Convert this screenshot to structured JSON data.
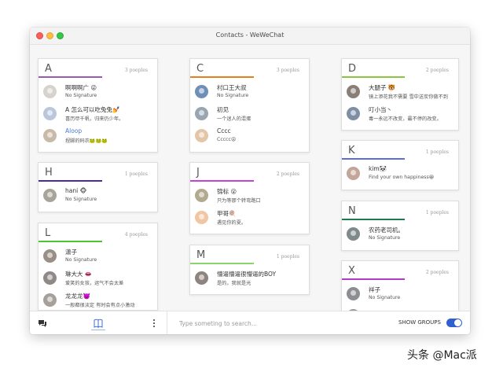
{
  "window": {
    "title": "Contacts - WeWeChat"
  },
  "groups": [
    {
      "letter": "A",
      "count": "3 poeples",
      "accent": "#9b59b6",
      "contacts": [
        {
          "name": "啊啊啊广 😜",
          "signature": "No Signature",
          "avatar_color": "#d7d2cc"
        },
        {
          "name": "A 怎么可以吃兔兔💅",
          "signature": "喜历尽千帆，归来仍少年。",
          "avatar_color": "#b9c6db"
        },
        {
          "name": "Aloop",
          "signature": "捏脚的码农🐸🐸🐸",
          "avatar_color": "#c9b9a9",
          "link": true
        }
      ]
    },
    {
      "letter": "H",
      "count": "1 poeples",
      "accent": "#4a2aa0",
      "contacts": [
        {
          "name": "hani 🐵",
          "signature": "No Signature",
          "avatar_color": "#a9a49a"
        }
      ]
    },
    {
      "letter": "L",
      "count": "4 poeples",
      "accent": "#4cc531",
      "contacts": [
        {
          "name": "潇子",
          "signature": "No Signature",
          "avatar_color": "#9a8f86"
        },
        {
          "name": "琳大大 👄",
          "signature": "爱笑的女孩，运气不会太差",
          "avatar_color": "#8f8a87"
        },
        {
          "name": "龙龙龙👿",
          "signature": "一般都很淡定 有时会有点小激动",
          "avatar_color": "#a5a09a"
        }
      ]
    },
    {
      "letter": "C",
      "count": "3 poeples",
      "accent": "#e67e22",
      "contacts": [
        {
          "name": "村口王大叔",
          "signature": "No Signature",
          "avatar_color": "#6f8fb8"
        },
        {
          "name": "初见",
          "signature": "一个迷人的混蛋",
          "avatar_color": "#98a6b4"
        },
        {
          "name": "Cccc",
          "signature": "Ccccc😡",
          "avatar_color": "#e3c6a8"
        }
      ]
    },
    {
      "letter": "J",
      "count": "2 poeples",
      "accent": "#c243d6",
      "contacts": [
        {
          "name": "锦标 😮",
          "signature": "只为等那个转弯路口",
          "avatar_color": "#b3a98e"
        },
        {
          "name": "甲哥🍭",
          "signature": "遇见你的夏。",
          "avatar_color": "#f0c7a2"
        }
      ]
    },
    {
      "letter": "M",
      "count": "1 poeples",
      "accent": "#8cd36a",
      "contacts": [
        {
          "name": "懵逼懵逼很懵逼的BOY",
          "signature": "是的，我就是光",
          "avatar_color": "#8f8380"
        }
      ]
    },
    {
      "letter": "D",
      "count": "2 poeples",
      "accent": "#8bc53f",
      "contacts": [
        {
          "name": "大腿子 🐯",
          "signature": "镜上添花我不需要 雪中送炭你做不到",
          "avatar_color": "#8a7f77"
        },
        {
          "name": "叮小当丶",
          "signature": "毒一永远不改变，最不停的改变。",
          "avatar_color": "#7d8ea5"
        }
      ]
    },
    {
      "letter": "K",
      "count": "1 poeples",
      "accent": "#5b6fd6",
      "contacts": [
        {
          "name": "kim🐼",
          "signature": "Find your own happiness😀",
          "avatar_color": "#c3a59a"
        }
      ]
    },
    {
      "letter": "N",
      "count": "1 poeples",
      "accent": "#1e7b4f",
      "contacts": [
        {
          "name": "农药老司机。",
          "signature": "No Signature",
          "avatar_color": "#7f8a8a"
        }
      ]
    },
    {
      "letter": "X",
      "count": "2 poeples",
      "accent": "#b23ac9",
      "contacts": [
        {
          "name": "祥子",
          "signature": "No Signature",
          "avatar_color": "#8d8e92"
        },
        {
          "name": "",
          "signature": "",
          "avatar_color": "#9a9a9a"
        }
      ]
    }
  ],
  "bottombar": {
    "search_placeholder": "Type someting to search...",
    "show_groups_label": "SHOW GROUPS",
    "show_groups_on": true,
    "chat_icon": "chat-icon",
    "book_icon": "contacts-book-icon",
    "more_icon": "more-vertical-icon"
  },
  "watermark": "头条 @Mac派"
}
